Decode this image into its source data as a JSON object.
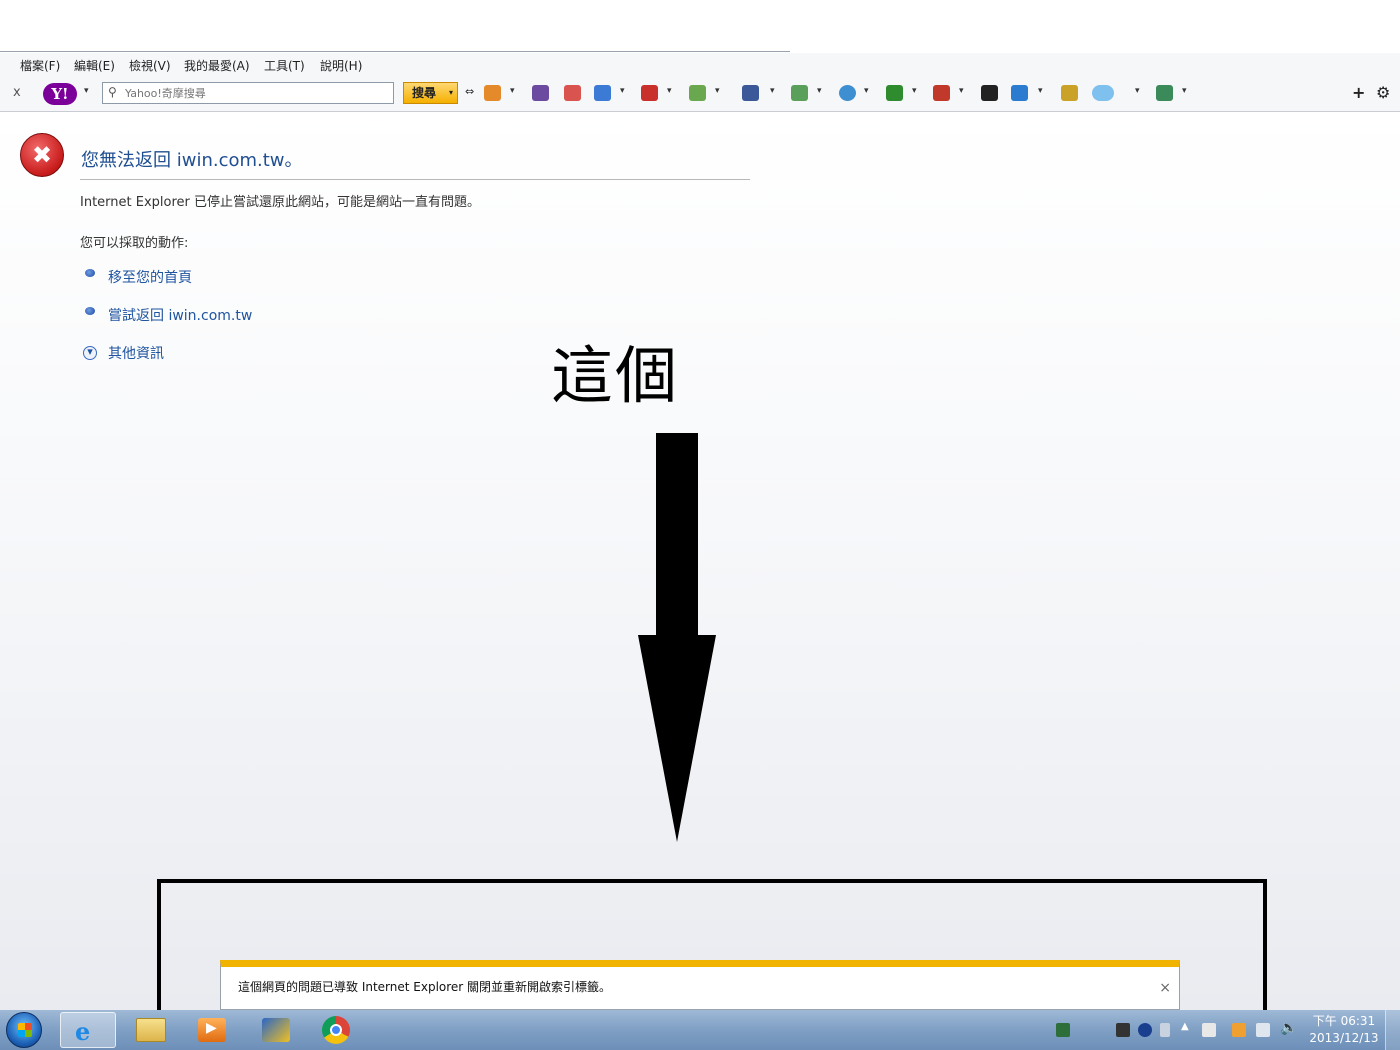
{
  "menu": [
    "檔案(F)",
    "編輯(E)",
    "檢視(V)",
    "我的最愛(A)",
    "工具(T)",
    "說明(H)"
  ],
  "toolbar": {
    "close": "x",
    "yahoo_logo": "Y!",
    "search_placeholder": "Yahoo!奇摩搜尋",
    "search_button": "搜尋",
    "add": "+",
    "settings": "⚙"
  },
  "error": {
    "title": "您無法返回 iwin.com.tw。",
    "description": "Internet Explorer 已停止嘗試還原此網站，可能是網站一直有問題。",
    "actions_label": "您可以採取的動作:",
    "actions": [
      "移至您的首頁",
      "嘗試返回 iwin.com.tw"
    ],
    "more_info": "其他資訊"
  },
  "annotation": {
    "text": "這個"
  },
  "notification": {
    "message": "這個網頁的問題已導致 Internet Explorer 關閉並重新開啟索引標籤。",
    "close": "×"
  },
  "taskbar": {
    "time": "下午 06:31",
    "date": "2013/12/13"
  },
  "colors": {
    "link": "#1f54a0",
    "error_red": "#c81b1b",
    "notification_accent": "#f0b400",
    "taskbar": "#7f9fc4"
  }
}
